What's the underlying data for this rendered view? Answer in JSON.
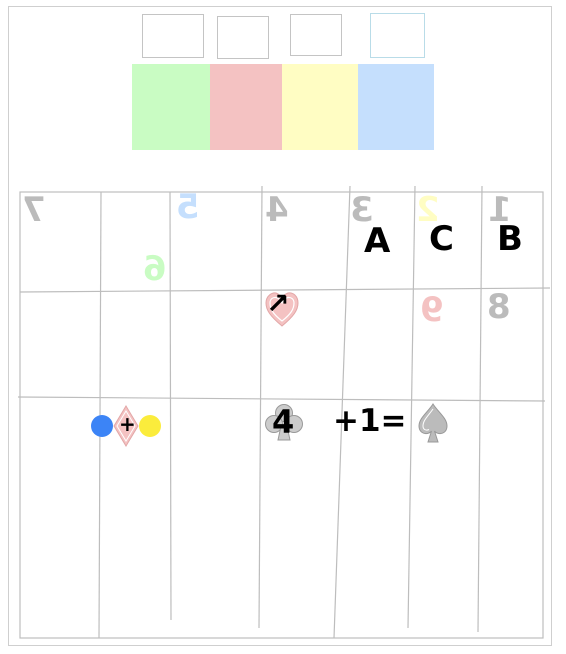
{
  "palette": {
    "green": "#c9fcc3",
    "red": "#f4c2c2",
    "yellow": "#fffdc3",
    "blue": "#c5dffd",
    "blue_outline": "#b9dce8",
    "gray": "#bbbbbb",
    "dot_blue": "#3c84f6",
    "dot_yellow": "#fbec3c"
  },
  "board": {
    "row1": {
      "mirrored_numbers": [
        {
          "text": "7",
          "color": "gray"
        },
        {
          "text": "5",
          "color": "blue"
        },
        {
          "text": "4",
          "color": "gray"
        },
        {
          "text": "3",
          "color": "gray"
        },
        {
          "text": "2",
          "color": "yellow"
        },
        {
          "text": "1",
          "color": "gray"
        },
        {
          "text": "6",
          "color": "green"
        }
      ],
      "letters": [
        "A",
        "C",
        "B"
      ]
    },
    "row2": {
      "suit": "heart",
      "symbol": "↗",
      "mirrored_numbers": [
        {
          "text": "9",
          "color": "red"
        },
        {
          "text": "8",
          "color": "gray"
        }
      ]
    },
    "row3": {
      "combo_left": "+",
      "combo_left_suit": "diamond",
      "club_value": "4",
      "expression": "+1=",
      "result_suit": "spade"
    }
  }
}
